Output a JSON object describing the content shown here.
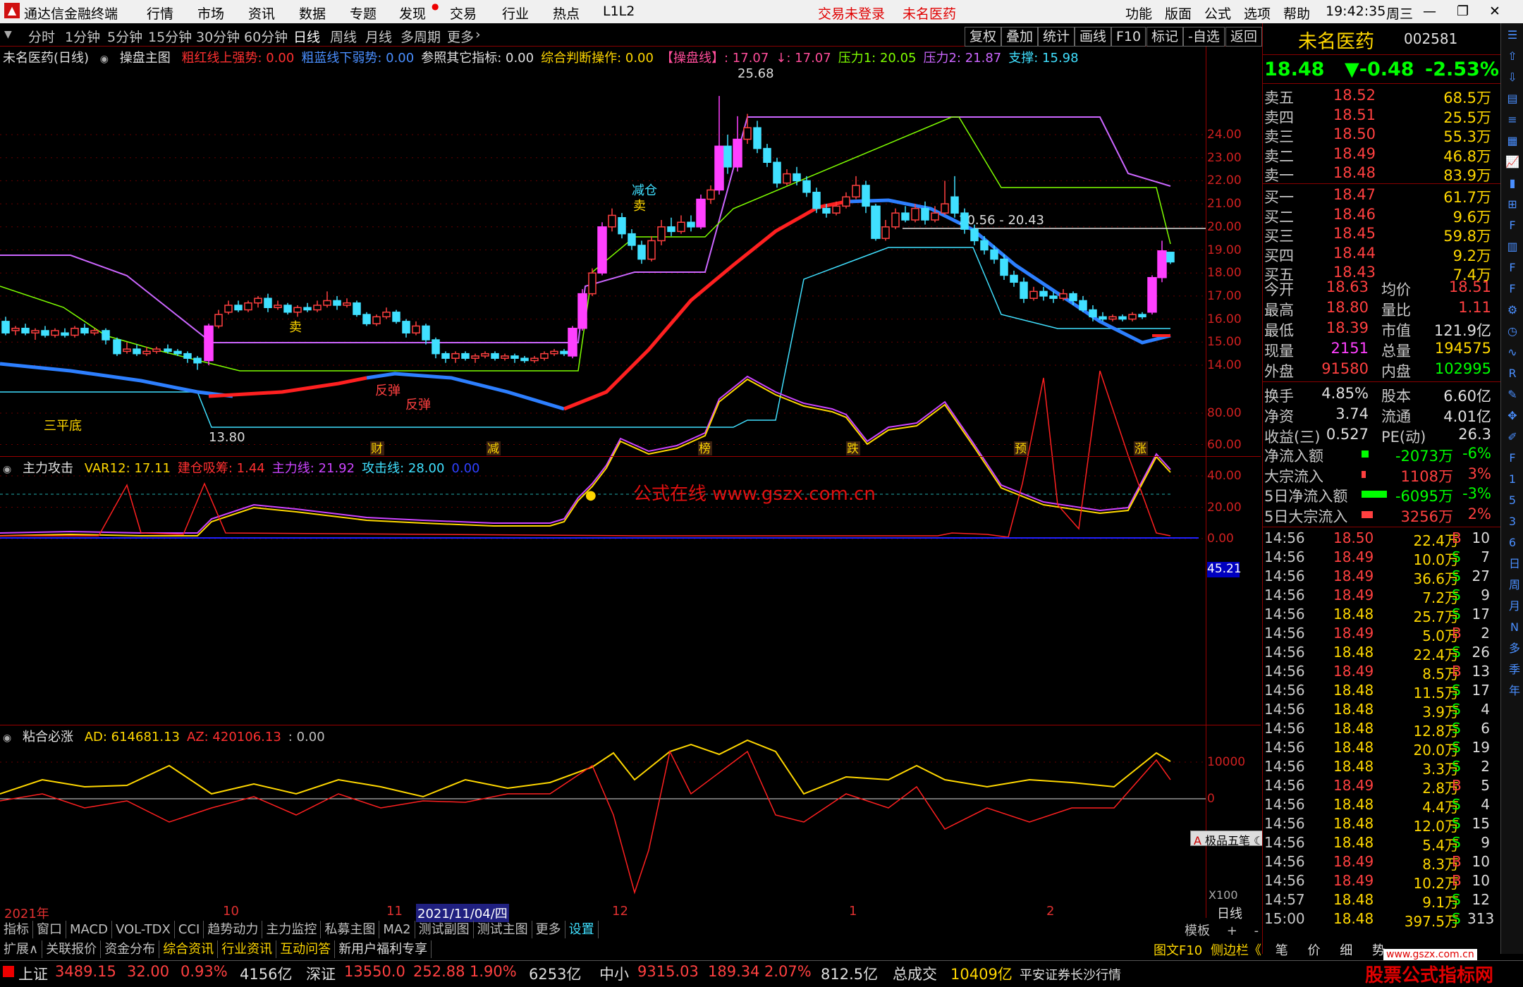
{
  "menubar": {
    "app_title": "通达信金融终端",
    "items": [
      "行情",
      "市场",
      "资讯",
      "数据",
      "专题",
      "发现",
      "交易",
      "行业",
      "热点",
      "L1L2"
    ],
    "login": "交易未登录",
    "stock_name": "未名医药",
    "right_items": [
      "功能",
      "版面",
      "公式",
      "选项",
      "帮助"
    ],
    "clock": "19:42:35",
    "weekday": "周三"
  },
  "timeframes": [
    "分时",
    "1分钟",
    "5分钟",
    "15分钟",
    "30分钟",
    "60分钟",
    "日线",
    "周线",
    "月线",
    "多周期",
    "更多"
  ],
  "active_timeframe": "日线",
  "toolbar_buttons": [
    "复权",
    "叠加",
    "统计",
    "画线",
    "F10",
    "标记",
    "-自选",
    "返回"
  ],
  "main_panel": {
    "title": "未名医药(日线)",
    "indicator": "操盘主图",
    "params": [
      {
        "text": "粗红线上强势: 0.00",
        "color": "#ff3030"
      },
      {
        "text": "粗蓝线下弱势: 0.00",
        "color": "#4a8fff"
      },
      {
        "text": "参照其它指标: 0.00",
        "color": "#e0e0e0"
      },
      {
        "text": "综合判断操作: 0.00",
        "color": "#ffd700"
      },
      {
        "text": "【操盘线】: 17.07",
        "color": "#ff4d9a"
      },
      {
        "text": "↓: 17.07",
        "color": "#ff4d9a"
      },
      {
        "text": "压力1: 20.05",
        "color": "#7fff00"
      },
      {
        "text": "压力2: 21.87",
        "color": "#cc66ff"
      },
      {
        "text": "支撑: 15.98",
        "color": "#40e0ff"
      }
    ],
    "yticks": [
      "24.00",
      "23.00",
      "22.00",
      "21.00",
      "20.00",
      "19.00",
      "18.00",
      "17.00",
      "16.00",
      "15.00",
      "14.00"
    ],
    "high_label": "25.68",
    "low_label": "13.80",
    "range_label": "20.56 - 20.43",
    "signals": [
      "三平底",
      "卖",
      "卖",
      "减仓",
      "反弹",
      "反弹"
    ],
    "event_marks": [
      "财",
      "减",
      "榜",
      "跌",
      "预",
      "涨"
    ]
  },
  "sub_panel1": {
    "name": "主力攻击",
    "params": [
      {
        "text": "VAR12: 17.11",
        "color": "#ffd700"
      },
      {
        "text": "建仓吸筹: 1.44",
        "color": "#ff3030"
      },
      {
        "text": "主力线: 21.92",
        "color": "#cc44ff"
      },
      {
        "text": "攻击线: 28.00",
        "color": "#40e0ff"
      },
      {
        "text": "0.00",
        "color": "#3040ff"
      }
    ],
    "yticks": [
      "80.00",
      "60.00",
      "40.00",
      "20.00",
      "0.00"
    ],
    "current_value": "45.21",
    "watermark": "公式在线  www.gszx.com.cn"
  },
  "sub_panel2": {
    "name": "粘合必涨",
    "params": [
      {
        "text": "AD: 614681.13",
        "color": "#ffd700"
      },
      {
        "text": "AZ: 420106.13",
        "color": "#ff3030"
      },
      {
        "text": ": 0.00",
        "color": "#c0c0c0"
      }
    ],
    "yticks": [
      "10000",
      "0"
    ],
    "scale": "X100",
    "addon": "极品五笔"
  },
  "xaxis": {
    "labels": [
      "2021年",
      "10",
      "11",
      "2021/11/04/四",
      "12",
      "1",
      "2"
    ],
    "period": "日线"
  },
  "bottom_tabs1": [
    "指标",
    "窗口",
    "MACD",
    "VOL-TDX",
    "CCI",
    "趋势动力",
    "主力监控",
    "私募主图",
    "MA2",
    "测试副图",
    "测试主图",
    "更多",
    "设置"
  ],
  "bottom_right1": [
    "模板",
    "+",
    "-"
  ],
  "bottom_tabs2": [
    "扩展∧",
    "关联报价",
    "资金分布",
    "综合资讯",
    "行业资讯",
    "互动问答",
    "新用户福利专享"
  ],
  "bottom_right2": [
    "图文F10",
    "侧边栏《",
    "笔",
    "价",
    "细",
    "势"
  ],
  "quote": {
    "name": "未名医药",
    "code": "002581",
    "price": "18.48",
    "change": "▼-0.48",
    "pct": "-2.53%",
    "asks": [
      {
        "label": "卖五",
        "price": "18.52",
        "vol": "68.5万"
      },
      {
        "label": "卖四",
        "price": "18.51",
        "vol": "25.5万"
      },
      {
        "label": "卖三",
        "price": "18.50",
        "vol": "55.3万"
      },
      {
        "label": "卖二",
        "price": "18.49",
        "vol": "46.8万"
      },
      {
        "label": "卖一",
        "price": "18.48",
        "vol": "83.9万"
      }
    ],
    "bids": [
      {
        "label": "买一",
        "price": "18.47",
        "vol": "61.7万"
      },
      {
        "label": "买二",
        "price": "18.46",
        "vol": "9.6万"
      },
      {
        "label": "买三",
        "price": "18.45",
        "vol": "59.8万"
      },
      {
        "label": "买四",
        "price": "18.44",
        "vol": "9.2万"
      },
      {
        "label": "买五",
        "price": "18.43",
        "vol": "7.4万"
      }
    ],
    "stats": [
      {
        "l1": "今开",
        "v1": "18.63",
        "c1": "#ff4040",
        "l2": "均价",
        "v2": "18.51",
        "c2": "#ff4040"
      },
      {
        "l1": "最高",
        "v1": "18.80",
        "c1": "#ff4040",
        "l2": "量比",
        "v2": "1.11",
        "c2": "#ff4040"
      },
      {
        "l1": "最低",
        "v1": "18.39",
        "c1": "#ff4040",
        "l2": "市值",
        "v2": "121.9亿",
        "c2": "#e0e0e0"
      },
      {
        "l1": "现量",
        "v1": "2151",
        "c1": "#ff40ff",
        "l2": "总量",
        "v2": "194575",
        "c2": "#ffd700"
      },
      {
        "l1": "外盘",
        "v1": "91580",
        "c1": "#ff4040",
        "l2": "内盘",
        "v2": "102995",
        "c2": "#00ff00"
      },
      {
        "l1": "换手",
        "v1": "4.85%",
        "c1": "#e0e0e0",
        "l2": "股本",
        "v2": "6.60亿",
        "c2": "#e0e0e0"
      },
      {
        "l1": "净资",
        "v1": "3.74",
        "c1": "#e0e0e0",
        "l2": "流通",
        "v2": "4.01亿",
        "c2": "#e0e0e0"
      },
      {
        "l1": "收益(三)",
        "v1": "0.527",
        "c1": "#e0e0e0",
        "l2": "PE(动)",
        "v2": "26.3",
        "c2": "#e0e0e0"
      }
    ],
    "flows": [
      {
        "label": "净流入额",
        "value": "-2073万",
        "pct": "-6%",
        "color": "#00ff00"
      },
      {
        "label": "大宗流入",
        "value": "1108万",
        "pct": "3%",
        "color": "#ff4040"
      },
      {
        "label": "5日净流入额",
        "value": "-6095万",
        "pct": "-3%",
        "color": "#00ff00"
      },
      {
        "label": "5日大宗流入",
        "value": "3256万",
        "pct": "2%",
        "color": "#ff4040"
      }
    ],
    "ticks": [
      {
        "t": "14:56",
        "p": "18.50",
        "v": "22.4万",
        "bs": "B",
        "n": "10"
      },
      {
        "t": "14:56",
        "p": "18.49",
        "v": "10.0万",
        "bs": "S",
        "n": "7"
      },
      {
        "t": "14:56",
        "p": "18.49",
        "v": "36.6万",
        "bs": "S",
        "n": "27"
      },
      {
        "t": "14:56",
        "p": "18.49",
        "v": "7.2万",
        "bs": "S",
        "n": "9"
      },
      {
        "t": "14:56",
        "p": "18.48",
        "v": "25.7万",
        "bs": "S",
        "n": "17"
      },
      {
        "t": "14:56",
        "p": "18.49",
        "v": "5.0万",
        "bs": "B",
        "n": "2"
      },
      {
        "t": "14:56",
        "p": "18.48",
        "v": "22.4万",
        "bs": "S",
        "n": "26"
      },
      {
        "t": "14:56",
        "p": "18.49",
        "v": "8.5万",
        "bs": "B",
        "n": "13"
      },
      {
        "t": "14:56",
        "p": "18.48",
        "v": "11.5万",
        "bs": "S",
        "n": "17"
      },
      {
        "t": "14:56",
        "p": "18.48",
        "v": "3.9万",
        "bs": "S",
        "n": "4"
      },
      {
        "t": "14:56",
        "p": "18.48",
        "v": "12.8万",
        "bs": "S",
        "n": "6"
      },
      {
        "t": "14:56",
        "p": "18.48",
        "v": "20.0万",
        "bs": "S",
        "n": "19"
      },
      {
        "t": "14:56",
        "p": "18.48",
        "v": "3.3万",
        "bs": "S",
        "n": "2"
      },
      {
        "t": "14:56",
        "p": "18.49",
        "v": "2.8万",
        "bs": "B",
        "n": "5"
      },
      {
        "t": "14:56",
        "p": "18.48",
        "v": "4.4万",
        "bs": "S",
        "n": "4"
      },
      {
        "t": "14:56",
        "p": "18.48",
        "v": "12.0万",
        "bs": "S",
        "n": "15"
      },
      {
        "t": "14:56",
        "p": "18.48",
        "v": "5.4万",
        "bs": "S",
        "n": "9"
      },
      {
        "t": "14:56",
        "p": "18.49",
        "v": "8.3万",
        "bs": "B",
        "n": "10"
      },
      {
        "t": "14:56",
        "p": "18.49",
        "v": "10.2万",
        "bs": "B",
        "n": "10"
      },
      {
        "t": "14:57",
        "p": "18.48",
        "v": "9.1万",
        "bs": "S",
        "n": "12"
      },
      {
        "t": "15:00",
        "p": "18.48",
        "v": "397.5万",
        "bs": "S",
        "n": "313"
      }
    ],
    "period_tabs": [
      "日",
      "周",
      "月",
      "N",
      "多",
      "季",
      "年"
    ]
  },
  "status": {
    "sh_label": "上证",
    "sh_val": "3489.15",
    "sh_chg": "32.00",
    "sh_pct": "0.93%",
    "sh_amt": "4156亿",
    "sz_label": "深证",
    "sz_val": "13550.0",
    "sz_chg": "252.88",
    "sz_pct": "1.90%",
    "sz_amt": "6253亿",
    "zx_label": "中小",
    "zx_val": "9315.03",
    "zx_chg": "189.34",
    "zx_pct": "2.07%",
    "zx_amt": "812.5亿",
    "total_label": "总成交",
    "total_val": "10409亿",
    "broker": "平安证券长沙行情",
    "logo": "股票公式指标网",
    "logo_url": "www.gszx.com.cn"
  },
  "colors": {
    "up": "#ff4040",
    "down": "#00ff00",
    "accent": "#ffd700",
    "candle_up": "#ff40ff",
    "candle_down": "#40e0ff"
  }
}
